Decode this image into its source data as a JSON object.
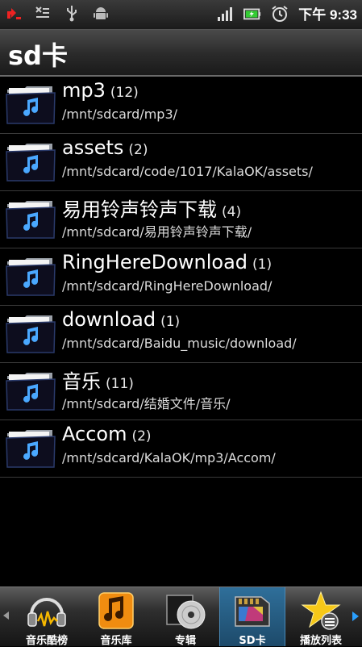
{
  "status_bar": {
    "time": "下午 9:33",
    "icons": [
      "usb-debug-icon",
      "missed-call-icon",
      "usb-icon",
      "android-icon",
      "signal-icon",
      "battery-icon",
      "alarm-clock-icon"
    ]
  },
  "header": {
    "title": "sd卡"
  },
  "folders": [
    {
      "name": "mp3",
      "count": "(12)",
      "path": "/mnt/sdcard/mp3/"
    },
    {
      "name": "assets",
      "count": "(2)",
      "path": "/mnt/sdcard/code/1017/KalaOK/assets/"
    },
    {
      "name": "易用铃声铃声下载",
      "count": "(4)",
      "path": "/mnt/sdcard/易用铃声铃声下载/"
    },
    {
      "name": "RingHereDownload",
      "count": "(1)",
      "path": "/mnt/sdcard/RingHereDownload/"
    },
    {
      "name": "download",
      "count": "(1)",
      "path": "/mnt/sdcard/Baidu_music/download/"
    },
    {
      "name": "音乐",
      "count": "(11)",
      "path": "/mnt/sdcard/结婚文件/音乐/"
    },
    {
      "name": "Accom",
      "count": "(2)",
      "path": "/mnt/sdcard/KalaOK/mp3/Accom/"
    }
  ],
  "tabs": [
    {
      "label": "音乐酷榜",
      "icon": "headphones-icon"
    },
    {
      "label": "音乐库",
      "icon": "music-library-icon"
    },
    {
      "label": "专辑",
      "icon": "album-disc-icon"
    },
    {
      "label": "SD卡",
      "icon": "sd-card-icon",
      "active": true
    },
    {
      "label": "播放列表",
      "icon": "star-playlist-icon"
    }
  ],
  "colors": {
    "background": "#000000",
    "active_tab": "#2f6f9a",
    "note_blue": "#4aa8ff"
  }
}
